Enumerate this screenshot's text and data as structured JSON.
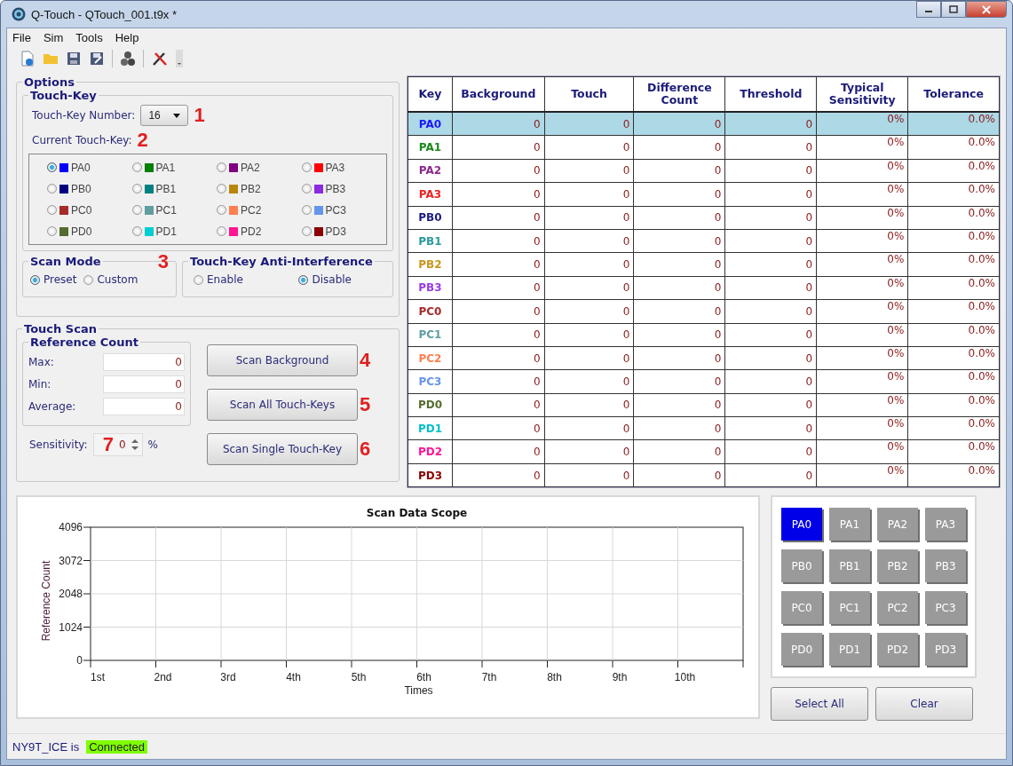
{
  "window": {
    "title": "Q-Touch - QTouch_001.t9x *"
  },
  "menu": [
    "File",
    "Sim",
    "Tools",
    "Help"
  ],
  "options": {
    "title": "Options",
    "touch_key": {
      "title": "Touch-Key",
      "number_label": "Touch-Key Number:",
      "number": "16",
      "number_note": "1",
      "current_label": "Current Touch-Key:",
      "current_note": "2"
    },
    "keys": [
      {
        "name": "PA0",
        "color": "#0000ff",
        "selected": true
      },
      {
        "name": "PA1",
        "color": "#008000",
        "selected": false
      },
      {
        "name": "PA2",
        "color": "#800080",
        "selected": false
      },
      {
        "name": "PA3",
        "color": "#ff0000",
        "selected": false
      },
      {
        "name": "PB0",
        "color": "#000080",
        "selected": false
      },
      {
        "name": "PB1",
        "color": "#008080",
        "selected": false
      },
      {
        "name": "PB2",
        "color": "#b8860b",
        "selected": false
      },
      {
        "name": "PB3",
        "color": "#8a2be2",
        "selected": false
      },
      {
        "name": "PC0",
        "color": "#a52a2a",
        "selected": false
      },
      {
        "name": "PC1",
        "color": "#5f9ea0",
        "selected": false
      },
      {
        "name": "PC2",
        "color": "#ff7f50",
        "selected": false
      },
      {
        "name": "PC3",
        "color": "#6495ed",
        "selected": false
      },
      {
        "name": "PD0",
        "color": "#556b2f",
        "selected": false
      },
      {
        "name": "PD1",
        "color": "#00ced1",
        "selected": false
      },
      {
        "name": "PD2",
        "color": "#ff1493",
        "selected": false
      },
      {
        "name": "PD3",
        "color": "#8b0000",
        "selected": false
      }
    ],
    "scan_mode": {
      "title": "Scan Mode",
      "note": "3",
      "options": [
        {
          "label": "Preset",
          "selected": true
        },
        {
          "label": "Custom",
          "selected": false
        }
      ]
    },
    "anti_interference": {
      "title": "Touch-Key Anti-Interference",
      "options": [
        {
          "label": "Enable",
          "selected": false
        },
        {
          "label": "Disable",
          "selected": true
        }
      ]
    }
  },
  "touch_scan": {
    "title": "Touch Scan",
    "reference_count": {
      "title": "Reference Count",
      "fields": [
        {
          "label": "Max:",
          "value": "0"
        },
        {
          "label": "Min:",
          "value": "0"
        },
        {
          "label": "Average:",
          "value": "0"
        }
      ]
    },
    "sensitivity": {
      "label": "Sensitivity:",
      "note": "7",
      "value": "0",
      "unit": "%"
    },
    "buttons": [
      {
        "label": "Scan Background",
        "note": "4"
      },
      {
        "label": "Scan All Touch-Keys",
        "note": "5"
      },
      {
        "label": "Scan Single Touch-Key",
        "note": "6"
      }
    ]
  },
  "table": {
    "columns": [
      "Key",
      "Background",
      "Touch",
      "Difference Count",
      "Threshold",
      "Typical Sensitivity",
      "Tolerance"
    ],
    "rows": [
      {
        "color": "#1a1aff",
        "selected": true,
        "cells": [
          "PA0",
          "0",
          "0",
          "0",
          "0",
          "0%",
          "0.0%"
        ]
      },
      {
        "color": "#1a8a1a",
        "selected": false,
        "cells": [
          "PA1",
          "0",
          "0",
          "0",
          "0",
          "0%",
          "0.0%"
        ]
      },
      {
        "color": "#8a2a8a",
        "selected": false,
        "cells": [
          "PA2",
          "0",
          "0",
          "0",
          "0",
          "0%",
          "0.0%"
        ]
      },
      {
        "color": "#ee2222",
        "selected": false,
        "cells": [
          "PA3",
          "0",
          "0",
          "0",
          "0",
          "0%",
          "0.0%"
        ]
      },
      {
        "color": "#1a1a80",
        "selected": false,
        "cells": [
          "PB0",
          "0",
          "0",
          "0",
          "0",
          "0%",
          "0.0%"
        ]
      },
      {
        "color": "#2a9a9a",
        "selected": false,
        "cells": [
          "PB1",
          "0",
          "0",
          "0",
          "0",
          "0%",
          "0.0%"
        ]
      },
      {
        "color": "#c8961b",
        "selected": false,
        "cells": [
          "PB2",
          "0",
          "0",
          "0",
          "0",
          "0%",
          "0.0%"
        ]
      },
      {
        "color": "#9a3be2",
        "selected": false,
        "cells": [
          "PB3",
          "0",
          "0",
          "0",
          "0",
          "0%",
          "0.0%"
        ]
      },
      {
        "color": "#a52a2a",
        "selected": false,
        "cells": [
          "PC0",
          "0",
          "0",
          "0",
          "0",
          "0%",
          "0.0%"
        ]
      },
      {
        "color": "#5f9ea0",
        "selected": false,
        "cells": [
          "PC1",
          "0",
          "0",
          "0",
          "0",
          "0%",
          "0.0%"
        ]
      },
      {
        "color": "#ff7f50",
        "selected": false,
        "cells": [
          "PC2",
          "0",
          "0",
          "0",
          "0",
          "0%",
          "0.0%"
        ]
      },
      {
        "color": "#6495ed",
        "selected": false,
        "cells": [
          "PC3",
          "0",
          "0",
          "0",
          "0",
          "0%",
          "0.0%"
        ]
      },
      {
        "color": "#556b2f",
        "selected": false,
        "cells": [
          "PD0",
          "0",
          "0",
          "0",
          "0",
          "0%",
          "0.0%"
        ]
      },
      {
        "color": "#00bfc8",
        "selected": false,
        "cells": [
          "PD1",
          "0",
          "0",
          "0",
          "0",
          "0%",
          "0.0%"
        ]
      },
      {
        "color": "#ff1493",
        "selected": false,
        "cells": [
          "PD2",
          "0",
          "0",
          "0",
          "0",
          "0%",
          "0.0%"
        ]
      },
      {
        "color": "#8b0000",
        "selected": false,
        "cells": [
          "PD3",
          "0",
          "0",
          "0",
          "0",
          "0%",
          "0.0%"
        ]
      }
    ]
  },
  "scope": {
    "chart_data": {
      "type": "line",
      "title": "Scan Data Scope",
      "xlabel": "Times",
      "ylabel": "Reference Count",
      "categories": [
        "1st",
        "2nd",
        "3rd",
        "4th",
        "5th",
        "6th",
        "7th",
        "8th",
        "9th",
        "10th"
      ],
      "ylim": [
        0,
        4096
      ],
      "grid": true,
      "yticks": [
        0,
        1024,
        2048,
        3072,
        4096
      ]
    }
  },
  "key_buttons": [
    {
      "label": "PA0",
      "selected": true
    },
    {
      "label": "PA1",
      "selected": false
    },
    {
      "label": "PA2",
      "selected": false
    },
    {
      "label": "PA3",
      "selected": false
    },
    {
      "label": "PB0",
      "selected": false
    },
    {
      "label": "PB1",
      "selected": false
    },
    {
      "label": "PB2",
      "selected": false
    },
    {
      "label": "PB3",
      "selected": false
    },
    {
      "label": "PC0",
      "selected": false
    },
    {
      "label": "PC1",
      "selected": false
    },
    {
      "label": "PC2",
      "selected": false
    },
    {
      "label": "PC3",
      "selected": false
    },
    {
      "label": "PD0",
      "selected": false
    },
    {
      "label": "PD1",
      "selected": false
    },
    {
      "label": "PD2",
      "selected": false
    },
    {
      "label": "PD3",
      "selected": false
    }
  ],
  "key_actions": [
    "Select All",
    "Clear"
  ],
  "status_bar": {
    "label": "NY9T_ICE is",
    "state": "Connected",
    "connected": true
  }
}
